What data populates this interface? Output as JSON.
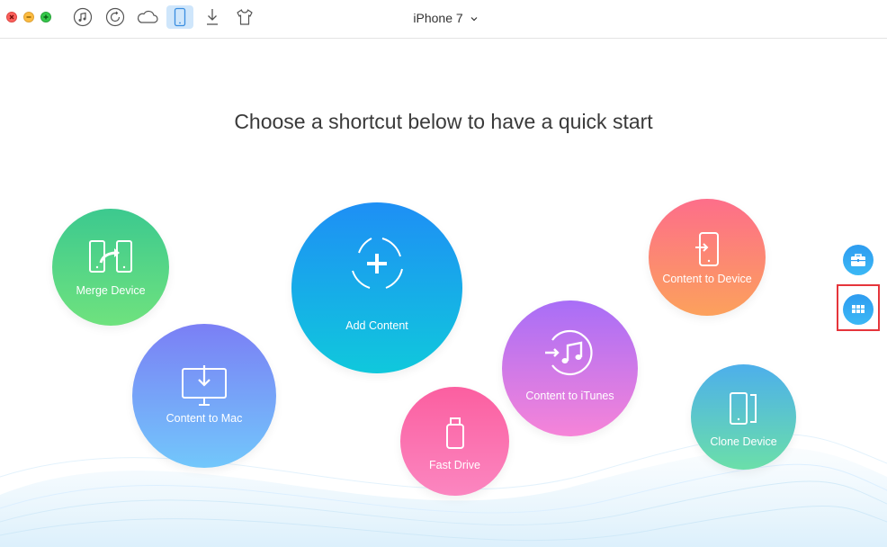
{
  "toolbar": {
    "tools": [
      {
        "name": "itunes-library",
        "icon": "music-note-icon"
      },
      {
        "name": "backup-manager",
        "icon": "history-icon"
      },
      {
        "name": "icloud-manager",
        "icon": "cloud-icon"
      },
      {
        "name": "device-manager",
        "icon": "phone-icon",
        "active": true
      },
      {
        "name": "downloader",
        "icon": "download-icon"
      },
      {
        "name": "skin",
        "icon": "tshirt-icon"
      }
    ],
    "device_name": "iPhone 7"
  },
  "main": {
    "heading": "Choose a shortcut below to have a quick start",
    "shortcuts": {
      "merge_device": "Merge Device",
      "content_to_mac": "Content to Mac",
      "add_content": "Add Content",
      "fast_drive": "Fast Drive",
      "content_to_itunes": "Content to iTunes",
      "content_to_device": "Content to Device",
      "clone_device": "Clone Device"
    }
  },
  "side": {
    "tools_icon": "toolbox-icon",
    "apps_icon": "grid-icon"
  },
  "colors": {
    "accent": "#2e9cf0",
    "highlight": "#e5353b",
    "active_tool_bg": "#cfe6fb"
  }
}
